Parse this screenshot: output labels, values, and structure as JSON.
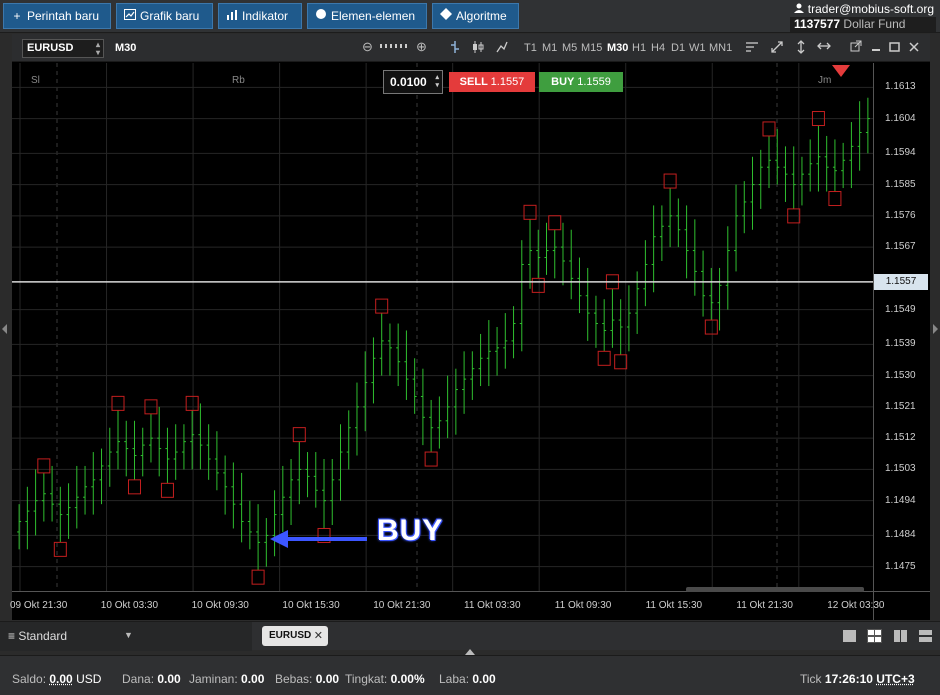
{
  "toolbar": {
    "new_order": "Perintah baru",
    "new_chart": "Grafik baru",
    "indicators": "Indikator",
    "elements": "Elemen-elemen",
    "algorithms": "Algoritme"
  },
  "account": {
    "user": "trader@mobius-soft.org",
    "fund_id": "1137577",
    "fund_name": "Dollar Fund"
  },
  "chart_header": {
    "symbol": "EURUSD",
    "current_timeframe": "M30",
    "timeframes": [
      "T1",
      "M1",
      "M5",
      "M15",
      "M30",
      "H1",
      "H4",
      "D1",
      "W1",
      "MN1"
    ],
    "active_timeframe": "M30"
  },
  "trade_panel": {
    "lot": "0.0100",
    "sell_label": "SELL",
    "sell_price": "1.1557",
    "buy_label": "BUY",
    "buy_price": "1.1559"
  },
  "sessions": [
    "Sl",
    "Rb",
    "Jm"
  ],
  "annotation": {
    "text": "BUY"
  },
  "chart_data": {
    "type": "candlestick",
    "symbol": "EURUSD",
    "timeframe": "M30",
    "current_price": "1.1557",
    "y_ticks": [
      "1.1613",
      "1.1604",
      "1.1594",
      "1.1585",
      "1.1576",
      "1.1567",
      "1.1557",
      "1.1549",
      "1.1539",
      "1.1530",
      "1.1521",
      "1.1512",
      "1.1503",
      "1.1494",
      "1.1484",
      "1.1475"
    ],
    "ylim": [
      1.1468,
      1.162
    ],
    "x_ticks": [
      "09 Okt 21:30",
      "10 Okt 03:30",
      "10 Okt 09:30",
      "10 Okt 15:30",
      "10 Okt 21:30",
      "11 Okt 03:30",
      "11 Okt 09:30",
      "11 Okt 15:30",
      "11 Okt 21:30",
      "12 Okt 03:30"
    ],
    "bar_colors": {
      "up": "#2fbf2f",
      "down": "#2fbf2f",
      "fractal_high": "#c41f1f",
      "fractal_low": "#c41f1f"
    },
    "closes": [
      1.1488,
      1.1491,
      1.1494,
      1.1496,
      1.1493,
      1.149,
      1.1492,
      1.1495,
      1.1498,
      1.15,
      1.1504,
      1.1508,
      1.1511,
      1.1509,
      1.1507,
      1.151,
      1.1512,
      1.1509,
      1.1506,
      1.1508,
      1.1511,
      1.1513,
      1.151,
      1.1506,
      1.1502,
      1.1498,
      1.1493,
      1.1488,
      1.1485,
      1.1482,
      1.1484,
      1.149,
      1.1495,
      1.15,
      1.1503,
      1.1501,
      1.1497,
      1.1494,
      1.15,
      1.1508,
      1.1515,
      1.1521,
      1.1528,
      1.1535,
      1.154,
      1.1538,
      1.1534,
      1.1529,
      1.1524,
      1.1518,
      1.1515,
      1.1517,
      1.1521,
      1.1526,
      1.1529,
      1.1532,
      1.1535,
      1.1537,
      1.1538,
      1.154,
      1.1545,
      1.1562,
      1.1566,
      1.1564,
      1.1566,
      1.1567,
      1.1563,
      1.1558,
      1.1553,
      1.1548,
      1.1545,
      1.1543,
      1.1546,
      1.1544,
      1.1548,
      1.1555,
      1.1562,
      1.157,
      1.1573,
      1.1576,
      1.1572,
      1.1566,
      1.156,
      1.1553,
      1.1551,
      1.1556,
      1.1566,
      1.1576,
      1.158,
      1.1585,
      1.159,
      1.1592,
      1.159,
      1.1588,
      1.1585,
      1.1588,
      1.1591,
      1.1593,
      1.159,
      1.1589,
      1.1592,
      1.1596,
      1.16,
      1.1604
    ]
  },
  "workspace": {
    "name": "Standard",
    "tab": "EURUSD"
  },
  "status": {
    "saldo_label": "Saldo:",
    "saldo": "0.00",
    "currency": "USD",
    "dana_label": "Dana:",
    "dana": "0.00",
    "jaminan_label": "Jaminan:",
    "jaminan": "0.00",
    "bebas_label": "Bebas:",
    "bebas": "0.00",
    "tingkat_label": "Tingkat:",
    "tingkat": "0.00%",
    "laba_label": "Laba:",
    "laba": "0.00",
    "tick_label": "Tick",
    "time": "17:26:10",
    "tz": "UTC+3"
  }
}
